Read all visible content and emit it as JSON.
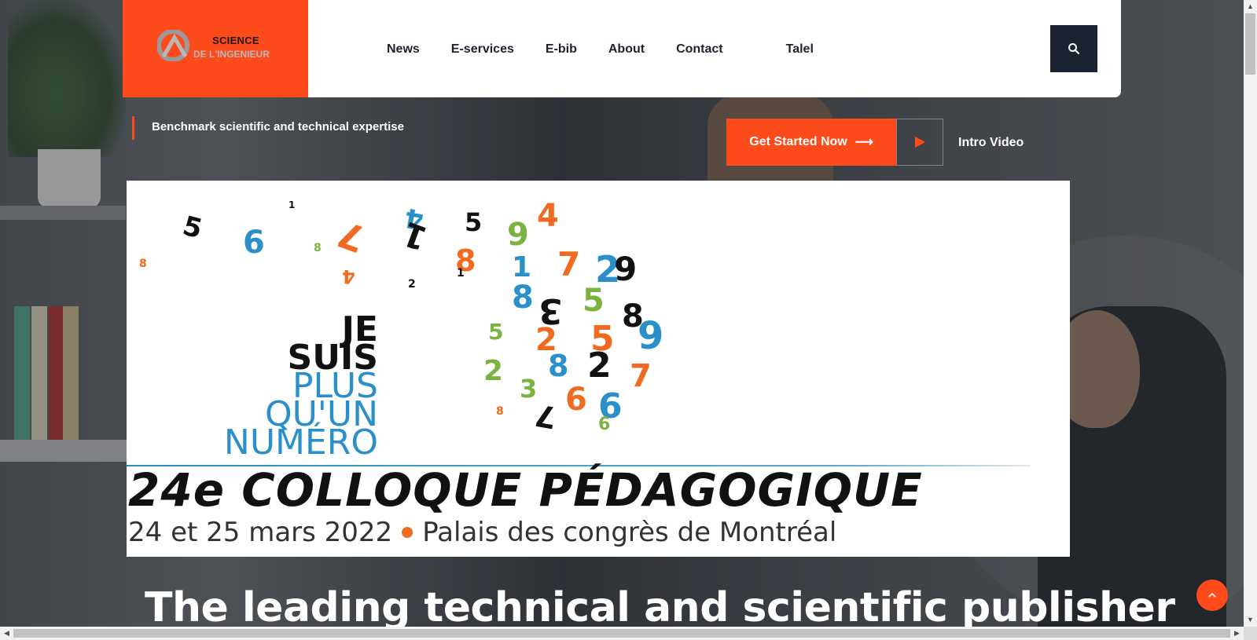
{
  "brand": {
    "line1": "SCIENCE",
    "line2": "DE L'INGENIEUR",
    "accent_color": "#fd4b1b",
    "dark_color": "#1b2230"
  },
  "nav": {
    "items": [
      "News",
      "E-services",
      "E-bib",
      "About",
      "Contact"
    ],
    "user": "Talel",
    "search_icon": "search-icon"
  },
  "hero": {
    "tagline": "Benchmark scientific and technical expertise",
    "cta_label": "Get Started Now",
    "cta_icon": "arrow-right-icon",
    "video_label": "Intro Video",
    "video_icon": "play-icon",
    "headline": "The leading technical and scientific publisher"
  },
  "poster": {
    "je": "JE",
    "suis": "SUIS",
    "plus": "PLUS",
    "quun": "QU'UN",
    "numero": "NUMÉRO",
    "colloque": "24e COLLOQUE PÉDAGOGIQUE",
    "dates_left": "24 et 25 mars 2022",
    "dates_right": "Palais des congrès de Montréal"
  },
  "back_to_top_icon": "chevron-up-icon"
}
